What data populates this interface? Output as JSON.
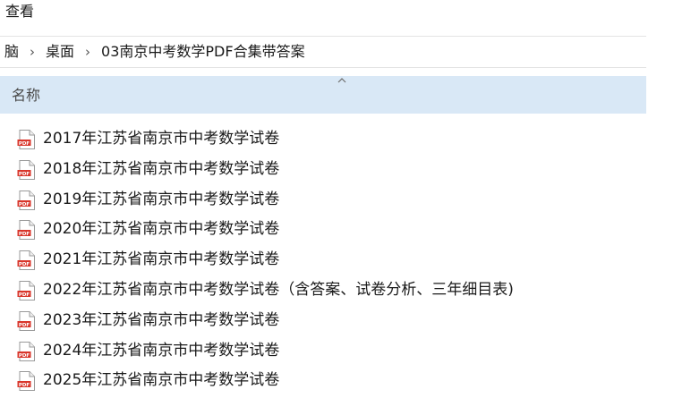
{
  "menubar": {
    "view_label": "查看"
  },
  "breadcrumb": {
    "items": [
      "脑",
      "桌面",
      "03南京中考数学PDF合集带答案"
    ],
    "separator": "›"
  },
  "columns": {
    "name_label": "名称"
  },
  "files": [
    {
      "name": "2017年江苏省南京市中考数学试卷",
      "icon": "pdf-icon"
    },
    {
      "name": "2018年江苏省南京市中考数学试卷",
      "icon": "pdf-icon"
    },
    {
      "name": "2019年江苏省南京市中考数学试卷",
      "icon": "pdf-icon"
    },
    {
      "name": "2020年江苏省南京市中考数学试卷",
      "icon": "pdf-icon"
    },
    {
      "name": "2021年江苏省南京市中考数学试卷",
      "icon": "pdf-icon"
    },
    {
      "name": "2022年江苏省南京市中考数学试卷（含答案、试卷分析、三年细目表)",
      "icon": "pdf-icon"
    },
    {
      "name": "2023年江苏省南京市中考数学试卷",
      "icon": "pdf-icon"
    },
    {
      "name": "2024年江苏省南京市中考数学试卷",
      "icon": "pdf-icon"
    },
    {
      "name": "2025年江苏省南京市中考数学试卷",
      "icon": "pdf-icon"
    }
  ],
  "colors": {
    "header_bg": "#d9e8f6",
    "pdf_red": "#d9362b"
  }
}
